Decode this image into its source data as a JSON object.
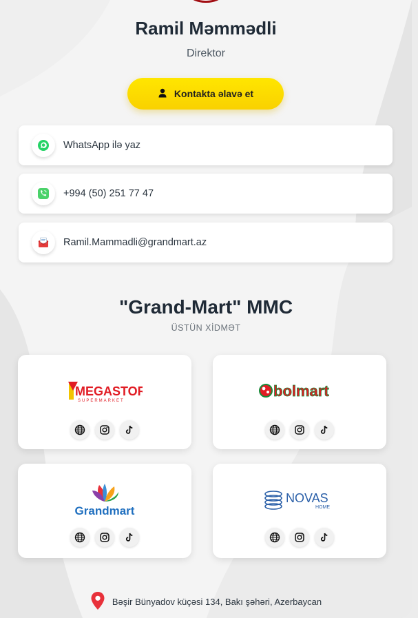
{
  "profile": {
    "name": "Ramil Məmmədli",
    "role": "Direktor",
    "add_contact_label": "Kontakta əlavə et"
  },
  "contacts": [
    {
      "icon": "whatsapp-icon",
      "label": "WhatsApp ilə yaz"
    },
    {
      "icon": "phone-icon",
      "label": "+994 (50) 251 77 47"
    },
    {
      "icon": "email-icon",
      "label": "Ramil.Mammadli@grandmart.az"
    }
  ],
  "company": {
    "name": "\"Grand-Mart\" MMC",
    "tagline": "ÜSTÜN XİDMƏT"
  },
  "brands": [
    {
      "name": "Megastore",
      "logo_text": "MEGASTORE",
      "logo_sub": "SUPERMARKET"
    },
    {
      "name": "Bolmart",
      "logo_text": "bolmart"
    },
    {
      "name": "Grandmart",
      "logo_text": "Grandmart"
    },
    {
      "name": "Novas Home",
      "logo_text": "NOVAS",
      "logo_sub": "HOME"
    }
  ],
  "social_icons": [
    "globe-icon",
    "instagram-icon",
    "tiktok-icon"
  ],
  "address": "Bəşir Bünyadov küçəsi 134, Bakı şəhəri, Azerbaycan",
  "colors": {
    "accent_yellow": "#ffe600",
    "whatsapp_green": "#25d366",
    "map_pin_red": "#e8313a",
    "text_dark": "#1f2a36"
  }
}
